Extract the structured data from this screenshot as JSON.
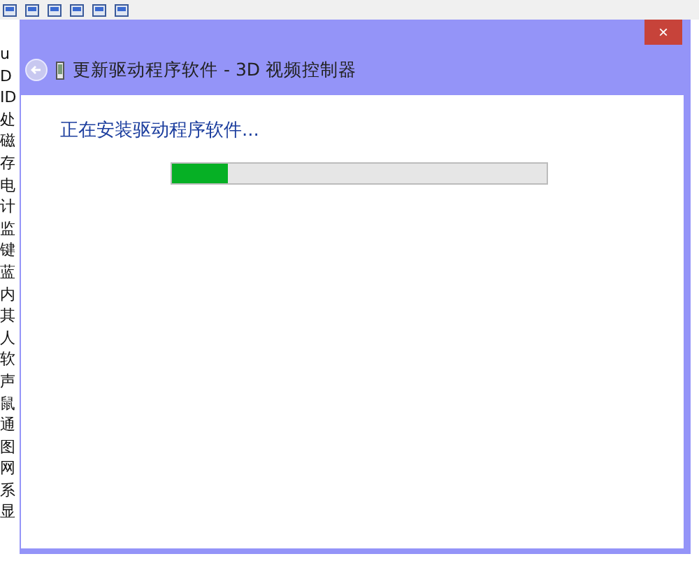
{
  "background_list": [
    "u",
    "D",
    "ID",
    "处",
    "磁",
    "存",
    "电",
    "计",
    "监",
    "键",
    "蓝",
    "内",
    "其",
    "人",
    "软",
    "声",
    "鼠",
    "通",
    "图",
    "网",
    "系",
    "显"
  ],
  "window": {
    "title": "更新驱动程序软件 - 3D 视频控制器",
    "close": "×"
  },
  "status": {
    "heading": "正在安装驱动程序软件...",
    "progress": {
      "level": 0.15
    }
  }
}
